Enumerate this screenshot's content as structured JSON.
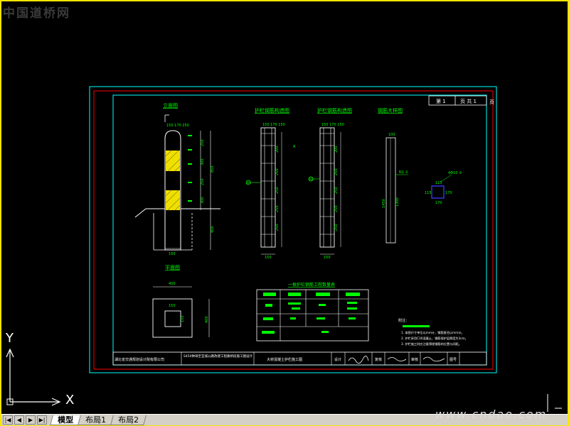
{
  "watermark_top": "中国道桥网",
  "watermark_bottom_right": "www.cndao.com",
  "ucs": {
    "y_label": "Y",
    "x_label": "X"
  },
  "tabs": {
    "model": "模型",
    "layout1": "布局1",
    "layout2": "布局2"
  },
  "title_block": {
    "sheet_no": "第 1",
    "sheet_total": "页 共 1",
    "sheet_page": "页",
    "org": "湖北省交通规划设计院有限公司",
    "project": "S450钟祥至宜城公路改建工程路桥段施工图设计",
    "drawing_title": "大桥混凝土护栏施工图",
    "design": "设计",
    "review": "复核",
    "check": "审核",
    "date": "图号"
  },
  "views": {
    "elevation": "立面图",
    "plan": "平面图",
    "rebar1": "护栏钢筋构造图",
    "rebar2": "护栏钢筋构造图",
    "detail": "钢筋大样图",
    "section": "1"
  },
  "dims": {
    "top_width": "150 170 250",
    "seg1": "250",
    "seg2": "300",
    "seg3": "250",
    "seg4": "300",
    "total_h": "850",
    "embed": "400",
    "base_w": "150",
    "plan_w": "400",
    "plan_inner": "150",
    "plan_inner2": "150",
    "plan_h": "400",
    "col_w1": "150",
    "col_w2": "150",
    "rebar_top": "100",
    "rebar_len": "1450",
    "rebar_len2": "1300",
    "sec_115": "115",
    "sec_170": "170",
    "sec_b": "170",
    "sec_side": "115",
    "rebar_label1": "N1",
    "rebar_label2": "N2",
    "sec_label": "4Φ10 ②"
  },
  "table": {
    "title": "一根护栏钢筋工程数量表"
  },
  "notes": {
    "heading": "附注：",
    "line1": "1. 本图尺寸单位以mm计，钢筋直径以mm计。",
    "line2": "2. 护栏采用C30混凝土，钢筋保护层厚度为3cm。",
    "line3": "3. 护栏施工时应注意预埋钢筋的位置与间距。"
  },
  "colors": {
    "frame": "#f5e600",
    "outer_border": "#ff0000",
    "inner_border": "#00ffff",
    "linework": "#ffffff",
    "text": "#00ff00",
    "hatch": "#ffff00"
  }
}
